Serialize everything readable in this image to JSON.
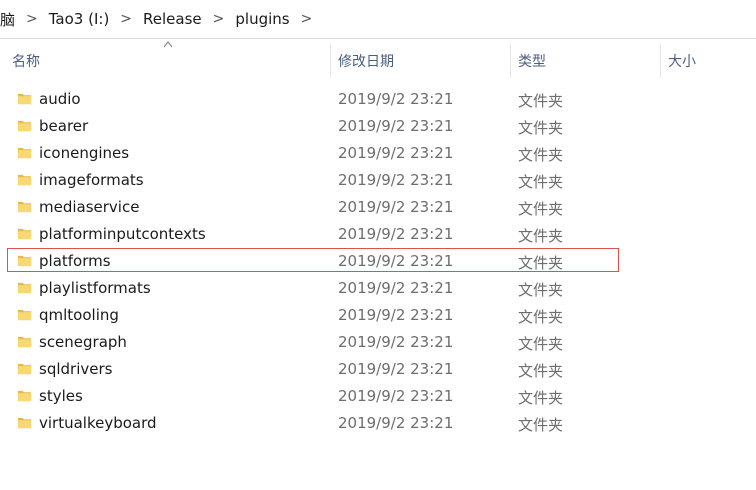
{
  "breadcrumb": {
    "items": [
      "脑",
      "Tao3 (I:)",
      "Release",
      "plugins"
    ],
    "separator": ">"
  },
  "columns": {
    "name": "名称",
    "date": "修改日期",
    "type": "类型",
    "size": "大小"
  },
  "sort": {
    "column": "name",
    "direction": "ascending"
  },
  "rows": [
    {
      "name": "audio",
      "date": "2019/9/2 23:21",
      "type": "文件夹"
    },
    {
      "name": "bearer",
      "date": "2019/9/2 23:21",
      "type": "文件夹"
    },
    {
      "name": "iconengines",
      "date": "2019/9/2 23:21",
      "type": "文件夹"
    },
    {
      "name": "imageformats",
      "date": "2019/9/2 23:21",
      "type": "文件夹"
    },
    {
      "name": "mediaservice",
      "date": "2019/9/2 23:21",
      "type": "文件夹"
    },
    {
      "name": "platforminputcontexts",
      "date": "2019/9/2 23:21",
      "type": "文件夹"
    },
    {
      "name": "platforms",
      "date": "2019/9/2 23:21",
      "type": "文件夹"
    },
    {
      "name": "playlistformats",
      "date": "2019/9/2 23:21",
      "type": "文件夹"
    },
    {
      "name": "qmltooling",
      "date": "2019/9/2 23:21",
      "type": "文件夹"
    },
    {
      "name": "scenegraph",
      "date": "2019/9/2 23:21",
      "type": "文件夹"
    },
    {
      "name": "sqldrivers",
      "date": "2019/9/2 23:21",
      "type": "文件夹"
    },
    {
      "name": "styles",
      "date": "2019/9/2 23:21",
      "type": "文件夹"
    },
    {
      "name": "virtualkeyboard",
      "date": "2019/9/2 23:21",
      "type": "文件夹"
    }
  ],
  "highlighted_row": "platforms",
  "colors": {
    "header_text": "#4b5e80",
    "meta_text": "#6d6d6d",
    "highlight_border": "#d9534f",
    "folder_fill": "#f8d775",
    "folder_shade": "#e8b84a"
  },
  "icons": {
    "folder": "folder-icon",
    "sort": "sort-ascending-icon"
  }
}
